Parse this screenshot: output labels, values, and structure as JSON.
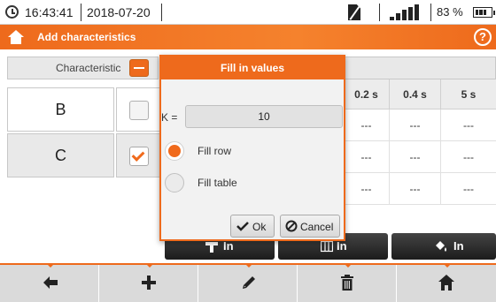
{
  "status": {
    "time": "16:43:41",
    "date": "2018-07-20",
    "battery": "83 %",
    "icons": [
      "clock-icon",
      "sim-card-icon",
      "signal-icon",
      "battery-icon"
    ]
  },
  "titlebar": {
    "title": "Add characteristics",
    "icons": [
      "home-icon",
      "help-icon"
    ]
  },
  "table": {
    "characteristic_header": "Characteristic",
    "time_headers": [
      "0.2 s",
      "0.4 s",
      "5 s"
    ],
    "rows": [
      {
        "label": "B",
        "checked": false,
        "cells": [
          "---",
          "---",
          "---"
        ]
      },
      {
        "label": "C",
        "checked": true,
        "cells": [
          "---",
          "---",
          "---"
        ]
      },
      {
        "label": "",
        "checked": false,
        "cells": [
          "---",
          "---",
          "---"
        ]
      }
    ]
  },
  "fill_buttons": [
    {
      "icon": "fill-row-icon",
      "label": "In"
    },
    {
      "icon": "fill-column-icon",
      "label": "In"
    },
    {
      "icon": "fill-table-icon",
      "label": "In"
    }
  ],
  "dialog": {
    "title": "Fill in values",
    "k_label": "K =",
    "k_value": "10",
    "options": [
      "Fill row",
      "Fill table"
    ],
    "selected_option": "Fill row",
    "ok_label": "Ok",
    "cancel_label": "Cancel"
  },
  "toolbar": {
    "buttons": [
      "back-arrow-icon",
      "add-icon",
      "edit-pencil-icon",
      "delete-trash-icon",
      "home-icon"
    ]
  },
  "colors": {
    "accent": "#ee6a1c",
    "dark_button": "#2a2a2a",
    "toolbar_bg": "#dadada"
  }
}
